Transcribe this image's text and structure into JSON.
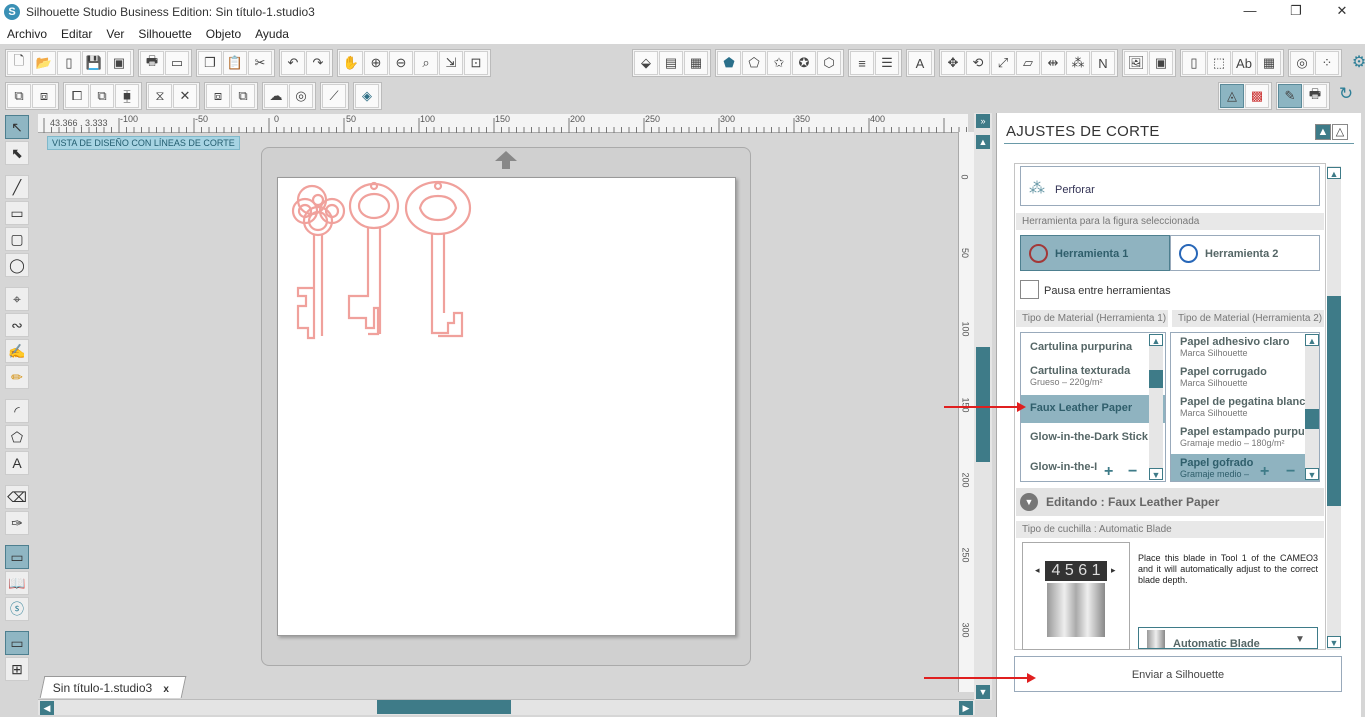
{
  "window": {
    "title": "Silhouette Studio Business Edition: Sin título-1.studio3",
    "minimize": "—",
    "maximize": "❐",
    "close": "✕"
  },
  "menu": [
    "Archivo",
    "Editar",
    "Ver",
    "Silhouette",
    "Objeto",
    "Ayuda"
  ],
  "canvas": {
    "view_label": "VISTA DE DISEÑO  CON LÍNEAS DE CORTE",
    "coords": "43.366 , 3.333",
    "ruler_top": [
      "-100",
      "-50",
      "0",
      "50",
      "100",
      "150",
      "200",
      "250",
      "300",
      "350",
      "400"
    ],
    "ruler_left": [
      "0",
      "50",
      "100",
      "150",
      "200",
      "250",
      "300"
    ],
    "tab": "Sin título-1.studio3",
    "tab_close": "x"
  },
  "panel": {
    "title": "AJUSTES DE CORTE",
    "perforar": "Perforar",
    "tool_section": "Herramienta para la figura seleccionada",
    "tool1": "Herramienta 1",
    "tool2": "Herramienta 2",
    "pause": "Pausa entre herramientas",
    "mat1_head": "Tipo de Material (Herramienta 1)",
    "mat2_head": "Tipo de Material (Herramienta 2)",
    "materials1": [
      {
        "t": "Cartulina purpurina",
        "s": ""
      },
      {
        "t": "Cartulina texturada",
        "s": "Grueso – 220g/m²"
      },
      {
        "t": "Faux Leather Paper",
        "s": ""
      },
      {
        "t": "Glow-in-the-Dark Stick",
        "s": ""
      },
      {
        "t": "Glow-in-the-I",
        "s": ""
      }
    ],
    "materials2": [
      {
        "t": "Papel adhesivo claro",
        "s": "Marca Silhouette"
      },
      {
        "t": "Papel corrugado",
        "s": "Marca Silhouette"
      },
      {
        "t": "Papel de pegatina blanc",
        "s": "Marca Silhouette"
      },
      {
        "t": "Papel estampado purpu",
        "s": "Gramaje medio – 180g/m²"
      },
      {
        "t": "Papel gofrado",
        "s": "Gramaje medio –"
      }
    ],
    "editing": "Editando : Faux Leather Paper",
    "blade_head": "Tipo de cuchilla : Automatic Blade",
    "blade_digits": "4 5 6 1",
    "blade_text": "Place this blade in Tool 1 of the CAMEO3 and it will automatically adjust to the correct blade depth.",
    "blade_select": "Automatic Blade",
    "send": "Enviar a Silhouette"
  },
  "colors": {
    "accent": "#3e7b88",
    "selected": "#8fb3c0",
    "keys_stroke": "#f0a19c",
    "arrow": "#e01f1f"
  }
}
